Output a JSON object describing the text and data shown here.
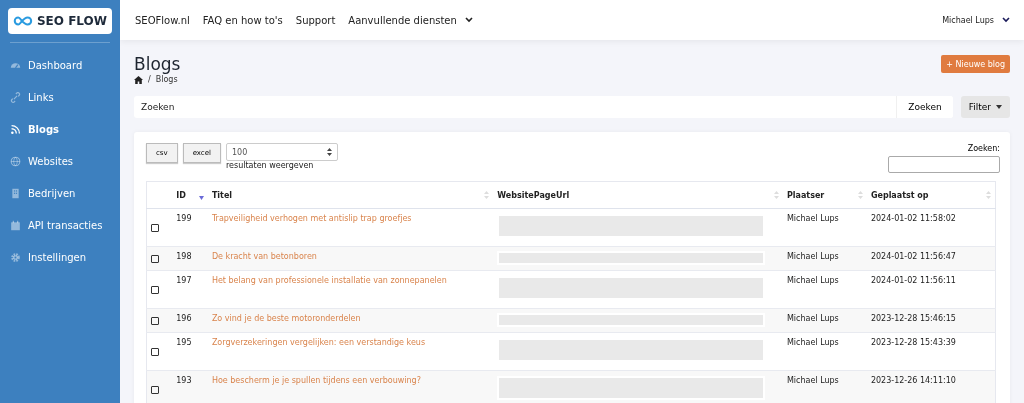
{
  "logo": {
    "text": "SEO FLOW"
  },
  "sidebar": {
    "items": [
      {
        "label": "Dashboard",
        "selected": false
      },
      {
        "label": "Links",
        "selected": false
      },
      {
        "label": "Blogs",
        "selected": true
      },
      {
        "label": "Websites",
        "selected": false
      },
      {
        "label": "Bedrijven",
        "selected": false
      },
      {
        "label": "API transacties",
        "selected": false
      },
      {
        "label": "Instellingen",
        "selected": false
      }
    ]
  },
  "topbar": {
    "links": [
      {
        "label": "SEOFlow.nl",
        "dropdown": false
      },
      {
        "label": "FAQ en how to's",
        "dropdown": false
      },
      {
        "label": "Support",
        "dropdown": false
      },
      {
        "label": "Aanvullende diensten",
        "dropdown": true
      }
    ],
    "user": "Michael Lups"
  },
  "page": {
    "title": "Blogs",
    "breadcrumb_separator": "/",
    "breadcrumb": "Blogs",
    "new_button": "+ Nieuwe blog"
  },
  "search": {
    "placeholder": "Zoeken",
    "button": "Zoeken",
    "filter": "Filter"
  },
  "table_tools": {
    "buttons": [
      "csv",
      "excel"
    ],
    "page_size": "100",
    "page_size_label": "resultaten weergeven",
    "search_label": "Zoeken:"
  },
  "table": {
    "columns": [
      {
        "label": "ID",
        "sorted": true
      },
      {
        "label": "Titel",
        "sorted": false
      },
      {
        "label": "WebsitePageUrl",
        "sorted": false
      },
      {
        "label": "Plaatser",
        "sorted": false
      },
      {
        "label": "Geplaatst op",
        "sorted": false
      }
    ],
    "rows": [
      {
        "checked": false,
        "id": "199",
        "title": "Trapveiligheid verhogen met antislip trap groefjes",
        "kind": "tall",
        "author": "Michael Lups",
        "date": "2024-01-02 11:58:02"
      },
      {
        "checked": false,
        "id": "198",
        "title": "De kracht van betonboren",
        "kind": "short",
        "author": "Michael Lups",
        "date": "2024-01-02 11:56:47"
      },
      {
        "checked": false,
        "id": "197",
        "title": "Het belang van professionele installatie van zonnepanelen",
        "kind": "tall",
        "author": "Michael Lups",
        "date": "2024-01-02 11:56:11"
      },
      {
        "checked": false,
        "id": "196",
        "title": "Zo vind je de beste motoronderdelen",
        "kind": "short",
        "author": "Michael Lups",
        "date": "2023-12-28 15:46:15"
      },
      {
        "checked": false,
        "id": "195",
        "title": "Zorgverzekeringen vergelijken: een verstandige keus",
        "kind": "tall",
        "author": "Michael Lups",
        "date": "2023-12-28 15:43:39"
      },
      {
        "checked": false,
        "id": "193",
        "title": "Hoe bescherm je je spullen tijdens een verbouwing?",
        "kind": "tall",
        "author": "Michael Lups",
        "date": "2023-12-26 14:11:10"
      }
    ]
  }
}
